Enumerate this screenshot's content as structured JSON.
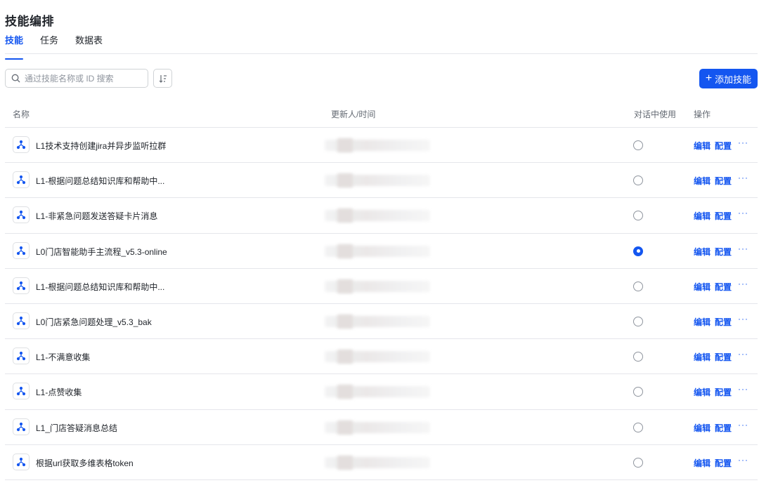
{
  "page": {
    "title": "技能编排"
  },
  "tabs": [
    {
      "label": "技能",
      "active": true
    },
    {
      "label": "任务",
      "active": false
    },
    {
      "label": "数据表",
      "active": false
    }
  ],
  "search": {
    "placeholder": "通过技能名称或 ID 搜索",
    "value": ""
  },
  "add_button": {
    "plus": "+",
    "label": "添加技能"
  },
  "table": {
    "headers": {
      "name": "名称",
      "updater": "更新人/时间",
      "in_use": "对话中使用",
      "actions": "操作"
    },
    "action_labels": {
      "edit": "编辑",
      "config": "配置",
      "more": "···"
    },
    "rows": [
      {
        "name": "L1技术支持创建jira并异步监听拉群",
        "in_use": false
      },
      {
        "name": "L1-根据问题总结知识库和帮助中...",
        "in_use": false
      },
      {
        "name": "L1-非紧急问题发送答疑卡片消息",
        "in_use": false
      },
      {
        "name": "L0门店智能助手主流程_v5.3-online",
        "in_use": true
      },
      {
        "name": "L1-根据问题总结知识库和帮助中...",
        "in_use": false
      },
      {
        "name": "L0门店紧急问题处理_v5.3_bak",
        "in_use": false
      },
      {
        "name": "L1-不满意收集",
        "in_use": false
      },
      {
        "name": "L1-点赞收集",
        "in_use": false
      },
      {
        "name": "L1_门店答疑消息总结",
        "in_use": false
      },
      {
        "name": "根据url获取多维表格token",
        "in_use": false
      }
    ]
  },
  "icons": {
    "search": "search-icon",
    "sort": "sort-icon",
    "skill": "workflow-icon"
  },
  "colors": {
    "accent": "#1456f0",
    "divider": "#e5e6eb",
    "muted_text": "#646a73"
  }
}
